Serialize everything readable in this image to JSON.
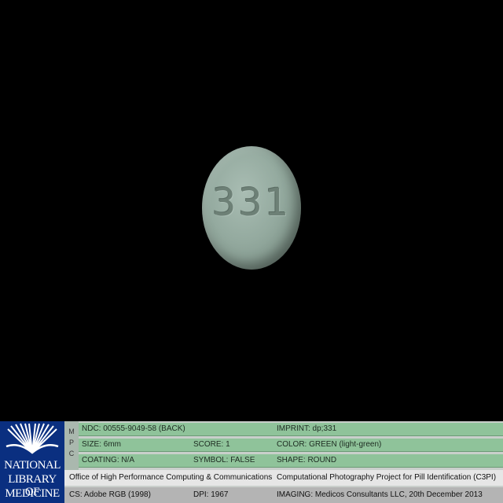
{
  "pill": {
    "imprint": "331",
    "color_hex": "#94aa9f"
  },
  "footer": {
    "logo": {
      "lines": [
        "NATIONAL",
        "LIBRARY OF",
        "MEDICINE"
      ]
    },
    "mpc": [
      "M",
      "P",
      "C"
    ],
    "rows": [
      [
        "NDC: 00555-9049-58 (BACK)",
        "IMPRINT: dp;331"
      ],
      [
        "SIZE: 6mm",
        "SCORE: 1",
        "COLOR: GREEN (light-green)"
      ],
      [
        "COATING: N/A",
        "SYMBOL: FALSE",
        "SHAPE: ROUND"
      ]
    ],
    "office_left": "Office of High Performance Computing & Communications",
    "office_right": "Computational Photography Project for Pill Identification (C3PI)",
    "cs": "CS: Adobe RGB (1998)",
    "dpi": "DPI: 1967",
    "imaging": "IMAGING: Medicos Consultants LLC, 20th December 2013"
  }
}
